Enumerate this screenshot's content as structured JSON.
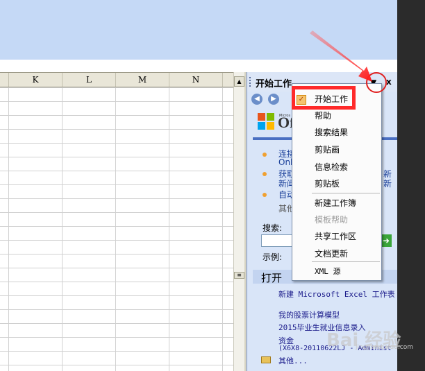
{
  "spreadsheet": {
    "columns": [
      "K",
      "L",
      "M",
      "N"
    ]
  },
  "taskpane": {
    "title": "开始工作",
    "dropdown_icon": "▼",
    "close_icon": "x",
    "office_logo_text": "Of",
    "office_logo_small": "Micros",
    "links": [
      {
        "line1": "连接",
        "line2": "Onl"
      },
      {
        "line1": "获取",
        "line2": "新闻"
      },
      {
        "line1": "自动",
        "line2": ""
      }
    ],
    "other_text": "其他",
    "right_fragments": [
      "新",
      "新"
    ],
    "search_label": "搜索:",
    "example_label": "示例:",
    "open_title": "打开",
    "open_items": [
      "新建 Microsoft Excel 工作表",
      "我的股票计算模型",
      "2015毕业生就业信息录入",
      "资金",
      "(X6X8-20110622LJ - Administ",
      "其他..."
    ]
  },
  "dropdown_menu": {
    "items": [
      {
        "label": "开始工作",
        "checked": true,
        "enabled": true
      },
      {
        "label": "帮助",
        "checked": false,
        "enabled": true
      },
      {
        "label": "搜索结果",
        "checked": false,
        "enabled": true
      },
      {
        "label": "剪贴画",
        "checked": false,
        "enabled": true
      },
      {
        "label": "信息检索",
        "checked": false,
        "enabled": true
      },
      {
        "label": "剪贴板",
        "checked": false,
        "enabled": true
      },
      {
        "label": "新建工作簿",
        "checked": false,
        "enabled": true
      },
      {
        "label": "模板帮助",
        "checked": false,
        "enabled": false
      },
      {
        "label": "共享工作区",
        "checked": false,
        "enabled": true
      },
      {
        "label": "文档更新",
        "checked": false,
        "enabled": true
      },
      {
        "label": "XML 源",
        "checked": false,
        "enabled": true
      }
    ]
  },
  "watermark": {
    "text": "Bai 经验",
    "sub": "jingyan.baidu.com"
  },
  "colors": {
    "highlight": "#ff2a2a",
    "toolbar_bg": "#c5d9f6",
    "taskpane_bg": "#d9e5f8"
  }
}
